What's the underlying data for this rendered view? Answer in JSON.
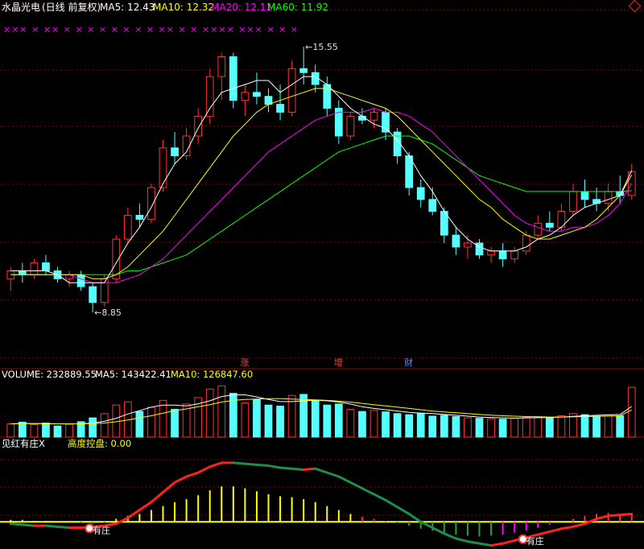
{
  "header": {
    "stock_name": "水晶光电",
    "mode": "(日线 前复权)",
    "ma5": "MA5: 12.43",
    "ma10": "MA10: 12.32",
    "ma20": "MA20: 12.11",
    "ma60": "MA60: 11.92"
  },
  "volume_header": {
    "label": "VOLUME: 232889.55",
    "ma5": "MA5: 143422.41",
    "ma10": "MA10: 126847.60"
  },
  "indicator_header": {
    "label": "见红有庄X",
    "control": "高度控盘: 0.00"
  },
  "colors": {
    "up": "#ff3232",
    "down": "#54ffff",
    "ma5": "#ffffff",
    "ma10": "#ffff00",
    "ma20": "#ff00ff",
    "ma60": "#00ff00",
    "grid": "#8b0000",
    "markers": "#ff00ff"
  },
  "chart_data": {
    "type": "candlestick",
    "price_ylim": [
      8,
      16
    ],
    "volume_ylim": [
      0,
      260000
    ],
    "annotations": [
      {
        "text": "15.55",
        "kind": "high"
      },
      {
        "text": "8.85",
        "kind": "low"
      }
    ],
    "signal_labels": [
      "涨",
      "增",
      "财"
    ],
    "indicator_labels": [
      "有庄",
      "有庄"
    ],
    "top_markers": "××× × ×× × × × × × × × × ×× × × ×××× ××× × × ×",
    "candles": [
      {
        "o": 9.7,
        "h": 10.0,
        "l": 9.4,
        "c": 9.9
      },
      {
        "o": 9.9,
        "h": 10.1,
        "l": 9.6,
        "c": 9.8
      },
      {
        "o": 9.8,
        "h": 10.2,
        "l": 9.7,
        "c": 10.1
      },
      {
        "o": 10.1,
        "h": 10.3,
        "l": 9.8,
        "c": 9.9
      },
      {
        "o": 9.9,
        "h": 10.0,
        "l": 9.6,
        "c": 9.7
      },
      {
        "o": 9.7,
        "h": 9.9,
        "l": 9.5,
        "c": 9.8
      },
      {
        "o": 9.8,
        "h": 9.9,
        "l": 9.4,
        "c": 9.5
      },
      {
        "o": 9.5,
        "h": 9.6,
        "l": 8.85,
        "c": 9.1
      },
      {
        "o": 9.1,
        "h": 9.8,
        "l": 9.0,
        "c": 9.7
      },
      {
        "o": 9.7,
        "h": 10.8,
        "l": 9.6,
        "c": 10.7
      },
      {
        "o": 10.7,
        "h": 11.5,
        "l": 10.6,
        "c": 11.3
      },
      {
        "o": 11.3,
        "h": 11.6,
        "l": 11.0,
        "c": 11.2
      },
      {
        "o": 11.2,
        "h": 12.1,
        "l": 11.1,
        "c": 12.0
      },
      {
        "o": 12.0,
        "h": 13.2,
        "l": 11.9,
        "c": 13.0
      },
      {
        "o": 13.0,
        "h": 13.4,
        "l": 12.6,
        "c": 12.8
      },
      {
        "o": 12.8,
        "h": 13.5,
        "l": 12.7,
        "c": 13.3
      },
      {
        "o": 13.3,
        "h": 14.0,
        "l": 13.1,
        "c": 13.8
      },
      {
        "o": 13.8,
        "h": 15.0,
        "l": 13.6,
        "c": 14.8
      },
      {
        "o": 14.8,
        "h": 15.4,
        "l": 14.2,
        "c": 15.3
      },
      {
        "o": 15.3,
        "h": 15.4,
        "l": 14.0,
        "c": 14.2
      },
      {
        "o": 14.2,
        "h": 14.6,
        "l": 13.8,
        "c": 14.4
      },
      {
        "o": 14.4,
        "h": 14.9,
        "l": 14.1,
        "c": 14.3
      },
      {
        "o": 14.3,
        "h": 14.5,
        "l": 13.9,
        "c": 14.1
      },
      {
        "o": 14.1,
        "h": 14.6,
        "l": 13.7,
        "c": 13.9
      },
      {
        "o": 13.9,
        "h": 15.2,
        "l": 13.8,
        "c": 15.0
      },
      {
        "o": 15.0,
        "h": 15.55,
        "l": 14.6,
        "c": 14.9
      },
      {
        "o": 14.9,
        "h": 15.1,
        "l": 14.4,
        "c": 14.6
      },
      {
        "o": 14.6,
        "h": 14.8,
        "l": 13.8,
        "c": 14.0
      },
      {
        "o": 14.0,
        "h": 14.2,
        "l": 13.1,
        "c": 13.3
      },
      {
        "o": 13.3,
        "h": 13.9,
        "l": 13.2,
        "c": 13.8
      },
      {
        "o": 13.8,
        "h": 14.0,
        "l": 13.6,
        "c": 13.7
      },
      {
        "o": 13.7,
        "h": 14.0,
        "l": 13.5,
        "c": 13.9
      },
      {
        "o": 13.9,
        "h": 14.0,
        "l": 13.2,
        "c": 13.4
      },
      {
        "o": 13.4,
        "h": 13.5,
        "l": 12.6,
        "c": 12.8
      },
      {
        "o": 12.8,
        "h": 12.9,
        "l": 11.8,
        "c": 12.0
      },
      {
        "o": 12.0,
        "h": 12.2,
        "l": 11.5,
        "c": 11.7
      },
      {
        "o": 11.7,
        "h": 12.0,
        "l": 11.3,
        "c": 11.4
      },
      {
        "o": 11.4,
        "h": 11.5,
        "l": 10.6,
        "c": 10.8
      },
      {
        "o": 10.8,
        "h": 11.0,
        "l": 10.3,
        "c": 10.5
      },
      {
        "o": 10.5,
        "h": 10.8,
        "l": 10.2,
        "c": 10.6
      },
      {
        "o": 10.6,
        "h": 10.7,
        "l": 10.2,
        "c": 10.3
      },
      {
        "o": 10.3,
        "h": 10.5,
        "l": 10.1,
        "c": 10.4
      },
      {
        "o": 10.4,
        "h": 10.6,
        "l": 10.0,
        "c": 10.2
      },
      {
        "o": 10.2,
        "h": 10.5,
        "l": 10.1,
        "c": 10.4
      },
      {
        "o": 10.4,
        "h": 10.9,
        "l": 10.3,
        "c": 10.8
      },
      {
        "o": 10.8,
        "h": 11.3,
        "l": 10.7,
        "c": 11.1
      },
      {
        "o": 11.1,
        "h": 11.4,
        "l": 10.9,
        "c": 11.0
      },
      {
        "o": 11.0,
        "h": 11.6,
        "l": 10.9,
        "c": 11.4
      },
      {
        "o": 11.4,
        "h": 12.1,
        "l": 11.3,
        "c": 11.9
      },
      {
        "o": 11.9,
        "h": 12.2,
        "l": 11.5,
        "c": 11.7
      },
      {
        "o": 11.7,
        "h": 12.0,
        "l": 11.4,
        "c": 11.6
      },
      {
        "o": 11.6,
        "h": 12.1,
        "l": 11.4,
        "c": 11.9
      },
      {
        "o": 11.9,
        "h": 12.3,
        "l": 11.6,
        "c": 11.8
      },
      {
        "o": 11.8,
        "h": 12.6,
        "l": 11.7,
        "c": 12.4
      }
    ],
    "ma5": [
      9.9,
      9.9,
      9.9,
      9.9,
      9.8,
      9.6,
      9.6,
      9.6,
      9.6,
      10.1,
      10.6,
      11.0,
      11.5,
      12.1,
      12.6,
      12.9,
      13.5,
      14.0,
      14.4,
      14.5,
      14.6,
      14.7,
      14.7,
      14.4,
      14.6,
      14.8,
      14.8,
      14.6,
      14.3,
      14.0,
      13.8,
      13.6,
      13.5,
      13.2,
      12.8,
      12.3,
      11.9,
      11.4,
      11.0,
      10.7,
      10.5,
      10.4,
      10.4,
      10.4,
      10.5,
      10.7,
      10.8,
      11.0,
      11.3,
      11.5,
      11.6,
      11.7,
      11.8,
      12.43
    ],
    "ma10": [
      9.8,
      9.8,
      9.8,
      9.8,
      9.8,
      9.8,
      9.8,
      9.7,
      9.7,
      9.8,
      10.0,
      10.3,
      10.6,
      10.9,
      11.3,
      11.7,
      12.1,
      12.5,
      12.9,
      13.3,
      13.6,
      13.9,
      14.1,
      14.2,
      14.3,
      14.4,
      14.5,
      14.5,
      14.4,
      14.3,
      14.2,
      14.1,
      14.0,
      13.8,
      13.5,
      13.2,
      12.9,
      12.6,
      12.3,
      12.0,
      11.7,
      11.5,
      11.2,
      11.0,
      10.8,
      10.7,
      10.7,
      10.8,
      10.9,
      11.0,
      11.2,
      11.5,
      11.8,
      12.32
    ],
    "ma20": [
      9.9,
      9.9,
      9.9,
      9.9,
      9.8,
      9.8,
      9.7,
      9.6,
      9.6,
      9.6,
      9.7,
      9.8,
      10.0,
      10.2,
      10.5,
      10.8,
      11.1,
      11.4,
      11.7,
      12.0,
      12.3,
      12.6,
      12.9,
      13.1,
      13.3,
      13.5,
      13.7,
      13.8,
      13.9,
      13.9,
      13.9,
      14.0,
      13.9,
      13.9,
      13.8,
      13.6,
      13.4,
      13.1,
      12.8,
      12.5,
      12.2,
      11.9,
      11.6,
      11.3,
      11.1,
      11.0,
      10.9,
      10.9,
      11.0,
      11.0,
      11.1,
      11.3,
      11.6,
      12.11
    ],
    "ma60": [
      9.8,
      9.8,
      9.8,
      9.8,
      9.8,
      9.8,
      9.8,
      9.8,
      9.8,
      9.8,
      9.9,
      9.9,
      10.0,
      10.1,
      10.2,
      10.3,
      10.5,
      10.7,
      10.9,
      11.1,
      11.3,
      11.5,
      11.7,
      11.9,
      12.1,
      12.3,
      12.5,
      12.7,
      12.9,
      13.0,
      13.1,
      13.2,
      13.3,
      13.3,
      13.3,
      13.2,
      13.1,
      12.9,
      12.7,
      12.5,
      12.3,
      12.2,
      12.1,
      12.0,
      11.9,
      11.9,
      11.9,
      11.9,
      11.9,
      11.9,
      11.9,
      11.9,
      11.9,
      11.92
    ],
    "volume": [
      62000,
      70000,
      58000,
      66000,
      52000,
      60000,
      72000,
      90000,
      110000,
      150000,
      165000,
      120000,
      140000,
      172000,
      130000,
      155000,
      185000,
      225000,
      240000,
      205000,
      160000,
      175000,
      150000,
      145000,
      195000,
      200000,
      170000,
      150000,
      155000,
      130000,
      120000,
      125000,
      118000,
      110000,
      105000,
      112000,
      98000,
      102000,
      96000,
      90000,
      88000,
      86000,
      84000,
      88000,
      92000,
      95000,
      90000,
      100000,
      110000,
      105000,
      98000,
      104000,
      100000,
      232889
    ],
    "vol_ma5": [
      62000,
      64000,
      63000,
      63000,
      62000,
      62000,
      62000,
      66000,
      74000,
      88000,
      108000,
      124000,
      140000,
      150000,
      150000,
      146000,
      156000,
      170000,
      190000,
      198000,
      198000,
      188000,
      176000,
      166000,
      166000,
      170000,
      172000,
      170000,
      164000,
      155000,
      142000,
      134000,
      128000,
      122000,
      116000,
      112000,
      110000,
      106000,
      102000,
      98000,
      94000,
      92000,
      90000,
      89000,
      90000,
      91000,
      92000,
      94000,
      97000,
      100000,
      102000,
      104000,
      106000,
      143422
    ],
    "vol_ma10": [
      62000,
      63000,
      63000,
      63000,
      62000,
      62000,
      62000,
      63000,
      66000,
      72000,
      80000,
      90000,
      100000,
      112000,
      124000,
      132000,
      142000,
      152000,
      164000,
      172000,
      176000,
      178000,
      180000,
      180000,
      178000,
      176000,
      174000,
      172000,
      168000,
      164000,
      158000,
      152000,
      146000,
      140000,
      134000,
      128000,
      122000,
      118000,
      114000,
      110000,
      106000,
      103000,
      100000,
      98000,
      96000,
      95000,
      94000,
      94000,
      95000,
      96000,
      97000,
      98000,
      100000,
      126847
    ],
    "indicator": {
      "bars": [
        0.2,
        0.2,
        0.1,
        0.1,
        0.0,
        0.0,
        -0.1,
        -0.2,
        -0.1,
        0.3,
        0.6,
        0.8,
        1.2,
        1.6,
        2.0,
        2.3,
        2.7,
        3.2,
        3.6,
        3.6,
        3.4,
        3.1,
        2.8,
        2.6,
        2.5,
        2.3,
        2.0,
        1.6,
        1.2,
        0.8,
        0.5,
        0.3,
        0.1,
        -0.1,
        -0.4,
        -0.7,
        -0.9,
        -1.1,
        -1.3,
        -1.4,
        -1.5,
        -1.4,
        -1.3,
        -1.1,
        -0.9,
        -0.6,
        -0.3,
        0.0,
        0.3,
        0.6,
        0.8,
        0.9,
        0.8,
        0.9
      ],
      "line": [
        -0.2,
        -0.3,
        -0.4,
        -0.4,
        -0.5,
        -0.6,
        -0.6,
        -0.5,
        -0.4,
        -0.2,
        0.4,
        1.2,
        2.0,
        3.0,
        4.0,
        4.6,
        5.0,
        5.6,
        6.0,
        6.0,
        5.9,
        5.8,
        5.7,
        5.5,
        5.4,
        5.3,
        5.4,
        5.0,
        4.6,
        4.0,
        3.4,
        2.8,
        2.2,
        1.5,
        0.8,
        0.0,
        -0.6,
        -1.2,
        -1.7,
        -2.0,
        -2.2,
        -2.4,
        -2.2,
        -1.9,
        -1.6,
        -1.3,
        -1.0,
        -0.7,
        -0.5,
        -0.2,
        0.3,
        0.6,
        0.7,
        0.8
      ],
      "ylim": [
        -2.6,
        6.4
      ]
    }
  }
}
